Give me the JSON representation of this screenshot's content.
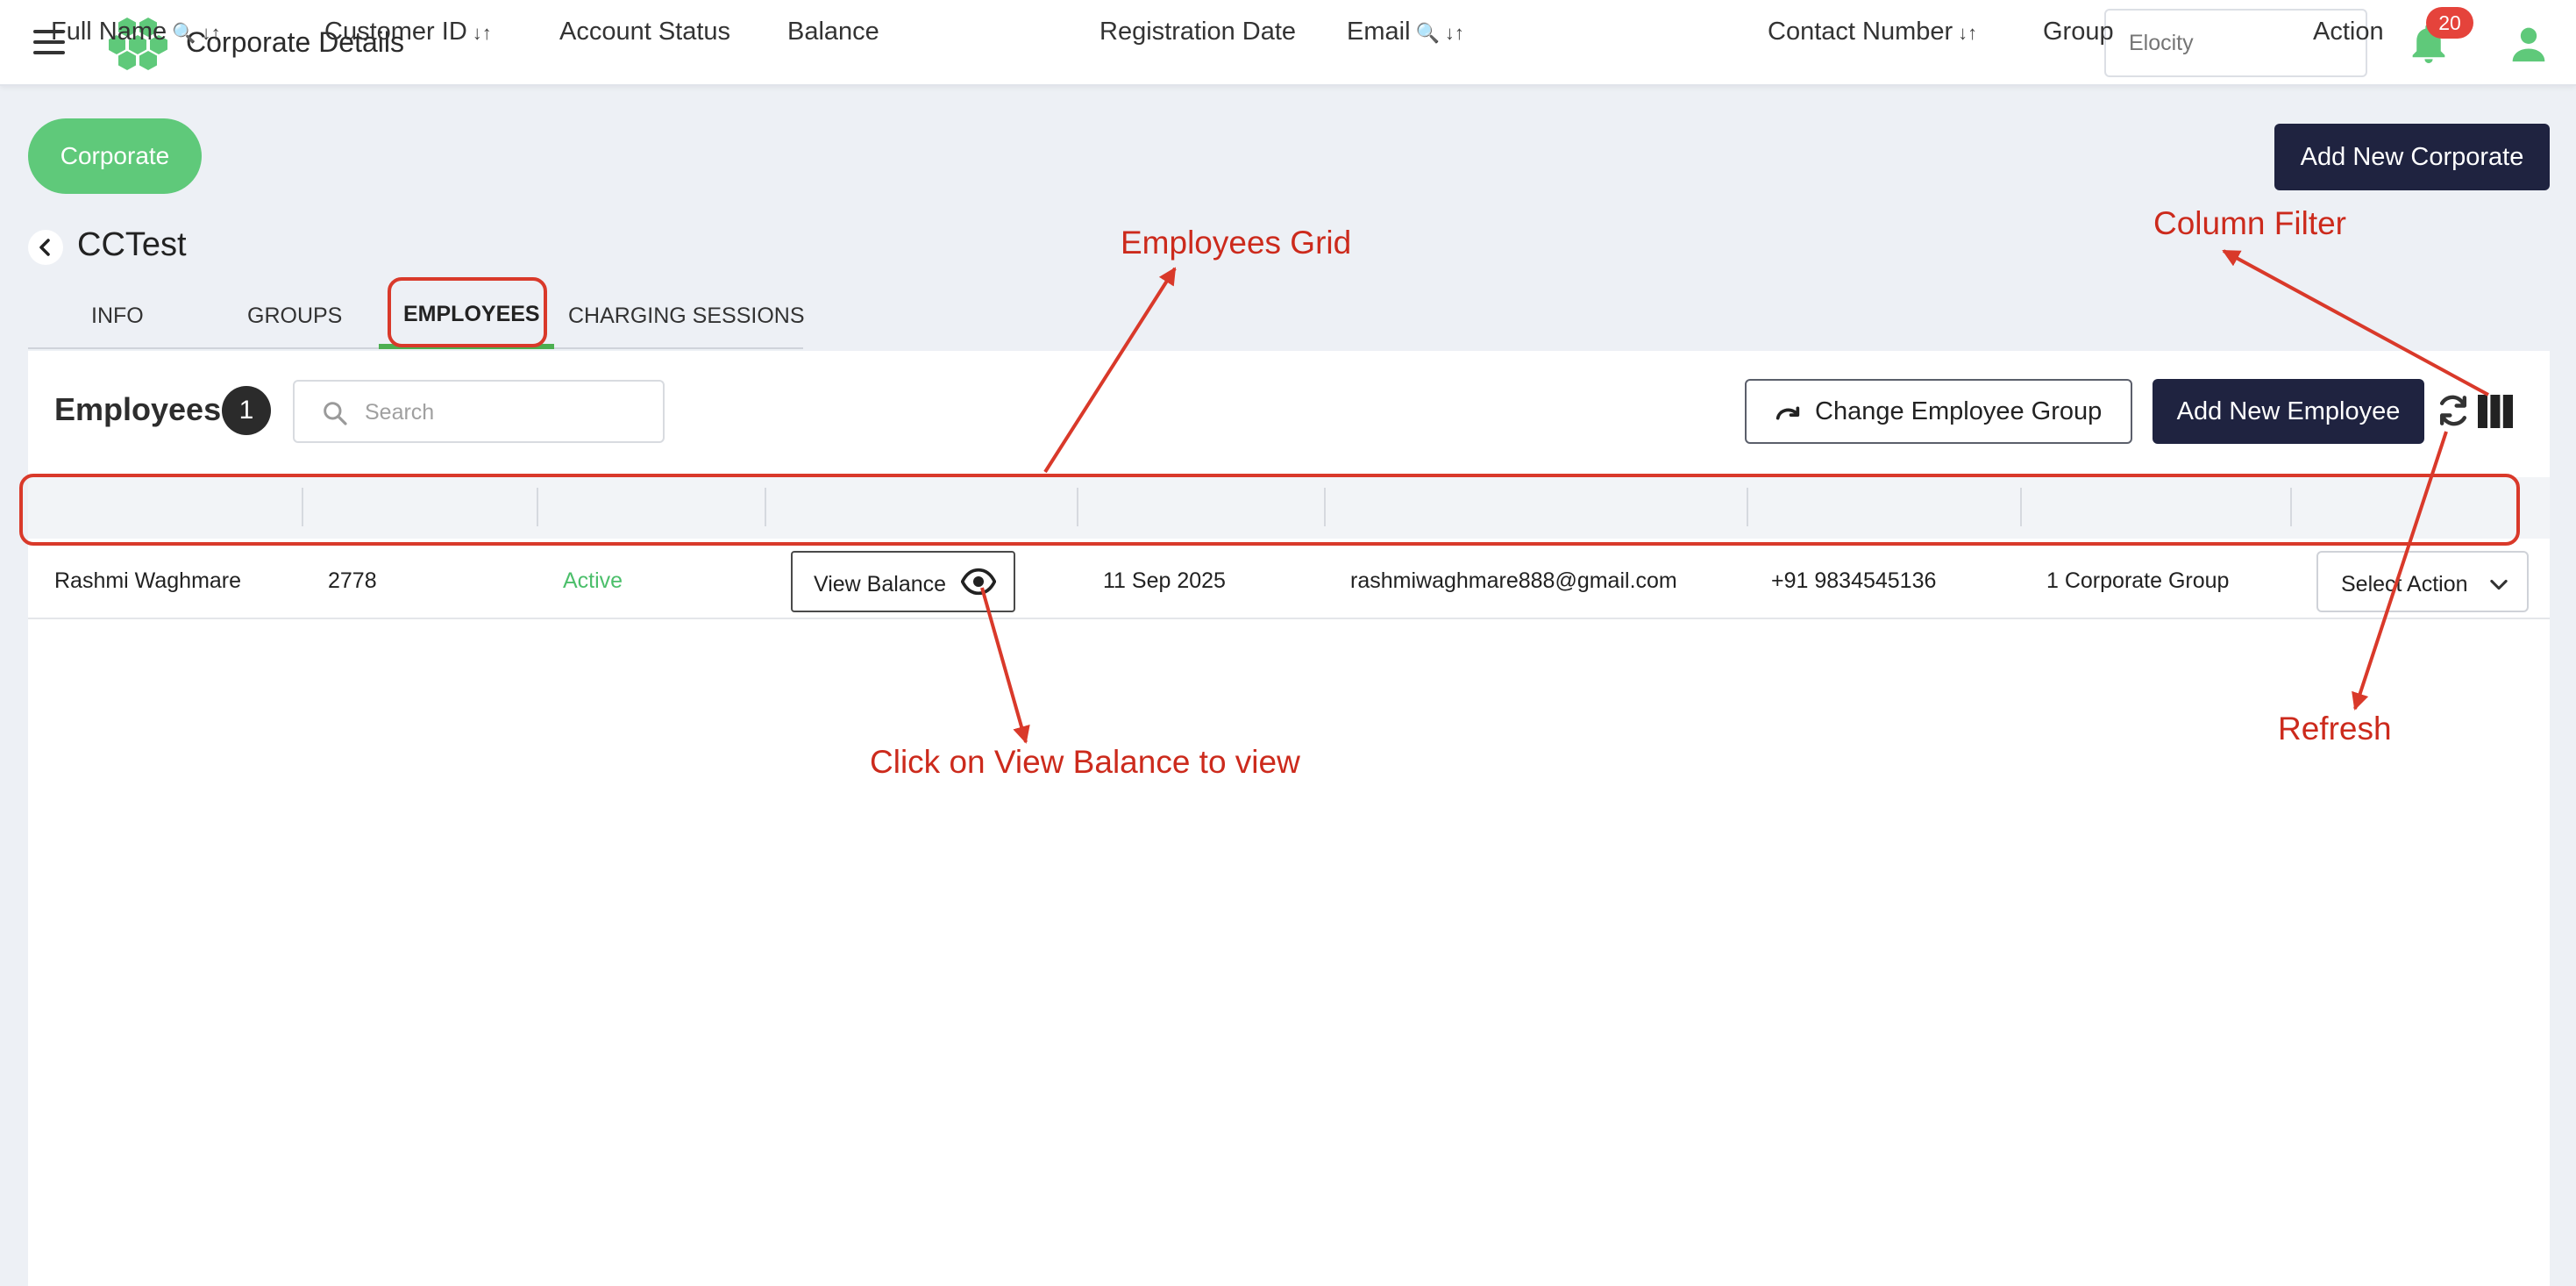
{
  "topbar": {
    "app_title": "Corporate Details",
    "tenant_placeholder": "Elocity",
    "notification_count": "20"
  },
  "header": {
    "corporate_pill": "Corporate",
    "add_corporate_label": "Add New Corporate",
    "corporate_name": "CCTest"
  },
  "tabs": [
    {
      "label": "INFO",
      "active": false
    },
    {
      "label": "GROUPS",
      "active": false
    },
    {
      "label": "EMPLOYEES",
      "active": true
    },
    {
      "label": "CHARGING SESSIONS",
      "active": false
    }
  ],
  "employees": {
    "title": "Employees",
    "count": "1",
    "search_placeholder": "Search",
    "change_group_label": "Change Employee Group",
    "add_employee_label": "Add New Employee"
  },
  "table": {
    "columns": [
      "Full Name",
      "Customer ID",
      "Account Status",
      "Balance",
      "Registration Date",
      "Email",
      "Contact Number",
      "Group",
      "Action"
    ],
    "rows": [
      {
        "full_name": "Rashmi Waghmare",
        "customer_id": "2778",
        "account_status": "Active",
        "balance_button": "View Balance",
        "registration_date": "11 Sep 2025",
        "email": "rashmiwaghmare888@gmail.com",
        "contact_number": "+91 9834545136",
        "group": "1 Corporate Group",
        "action_label": "Select Action"
      }
    ]
  },
  "annotations": {
    "employees_grid": "Employees Grid",
    "column_filter": "Column Filter",
    "view_balance_hint": "Click on View Balance to view",
    "refresh": "Refresh"
  },
  "colors": {
    "accent_green": "#5fc97a",
    "dark_button": "#1f2340",
    "annotation_red": "#d9392a",
    "badge_red": "#e5433b"
  }
}
